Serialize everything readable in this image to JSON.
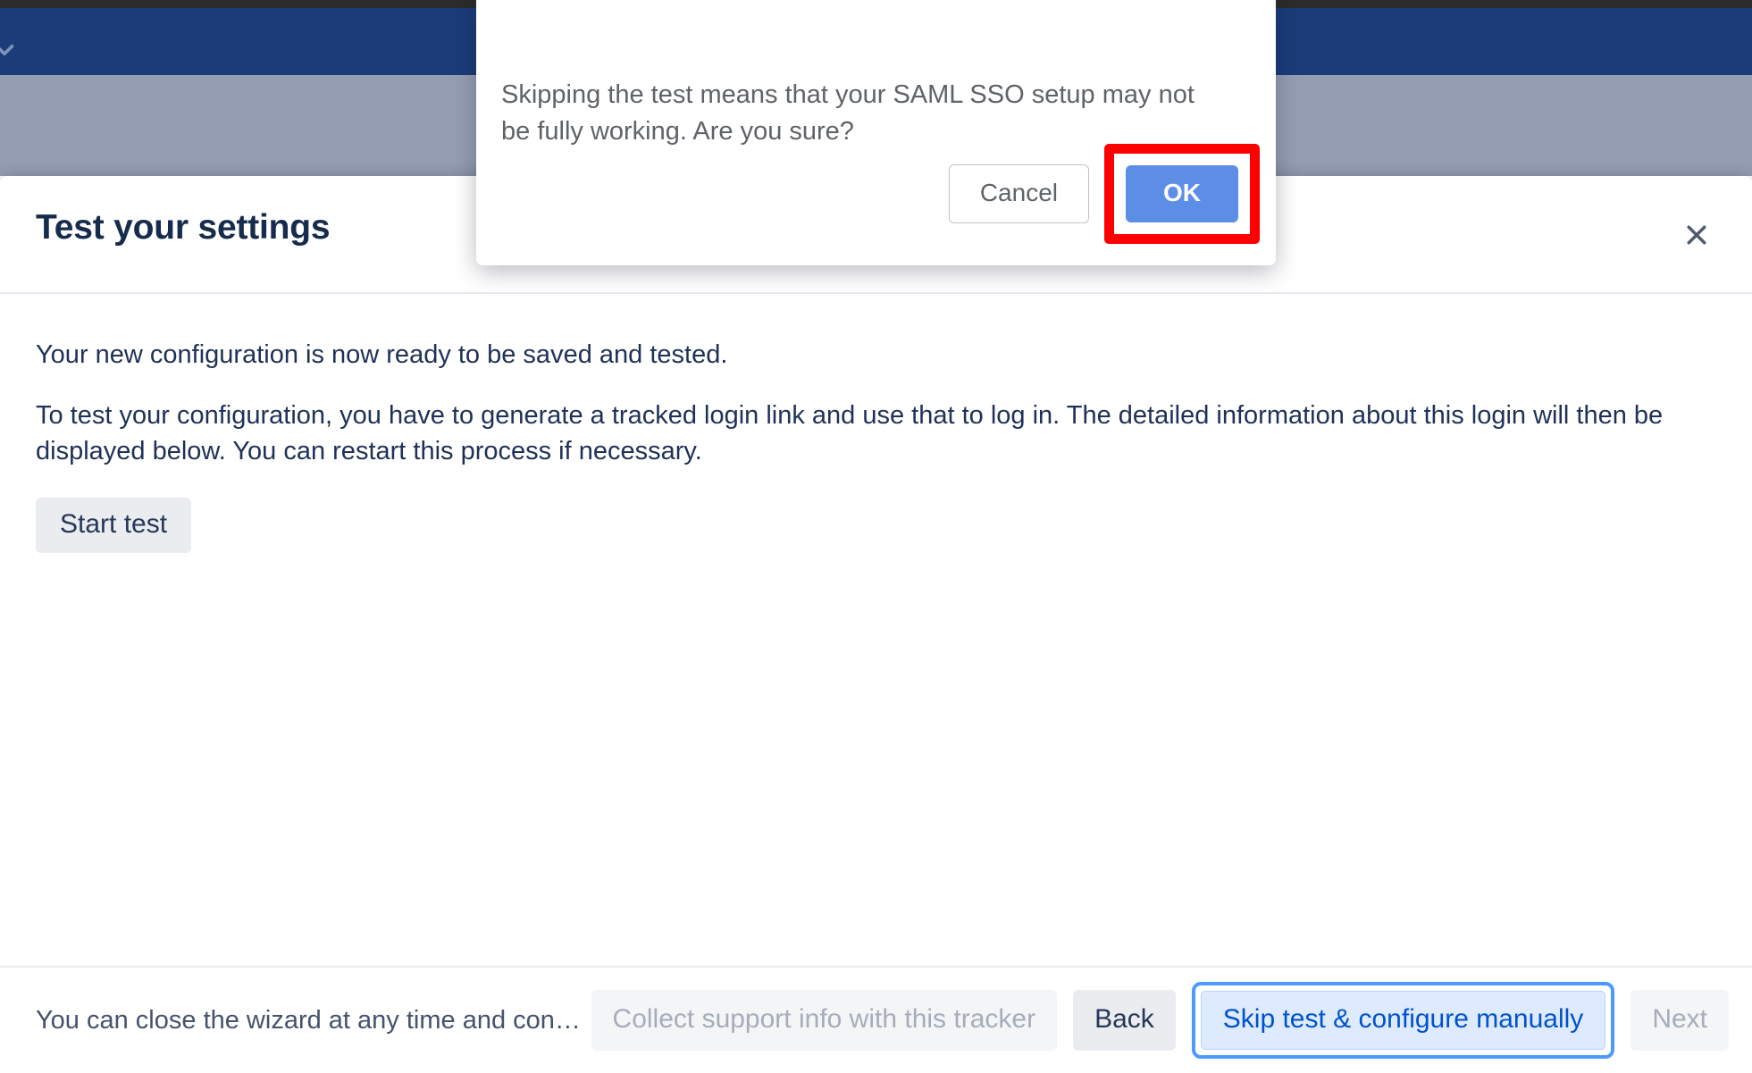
{
  "chrome": {
    "brand_chevron_icon": "chevron-down-icon"
  },
  "wizard": {
    "title": "Test your settings",
    "close_icon": "close-icon",
    "body": {
      "line1": "Your new configuration is now ready to be saved and tested.",
      "line2": "To test your configuration, you have to generate a tracked login link and use that to log in. The detailed information about this login will then be displayed below. You can restart this process if necessary.",
      "start_test_label": "Start test"
    },
    "footer": {
      "note": "You can close the wizard at any time and con…",
      "collect_tracker_label": "Collect support info with this tracker",
      "back_label": "Back",
      "skip_label": "Skip test & configure manually",
      "next_label": "Next"
    }
  },
  "confirm_dialog": {
    "message": "Skipping the test means that your SAML SSO setup may not be fully working. Are you sure?",
    "cancel_label": "Cancel",
    "ok_label": "OK"
  },
  "colors": {
    "brand_navy": "#1b3c79",
    "scrim_gray": "#959db3",
    "title_navy": "#172b4d",
    "accent_blue": "#0052cc",
    "focus_ring": "#4c9aff",
    "ok_button_blue": "#5d8ee6",
    "highlight_red": "#ff0000"
  }
}
